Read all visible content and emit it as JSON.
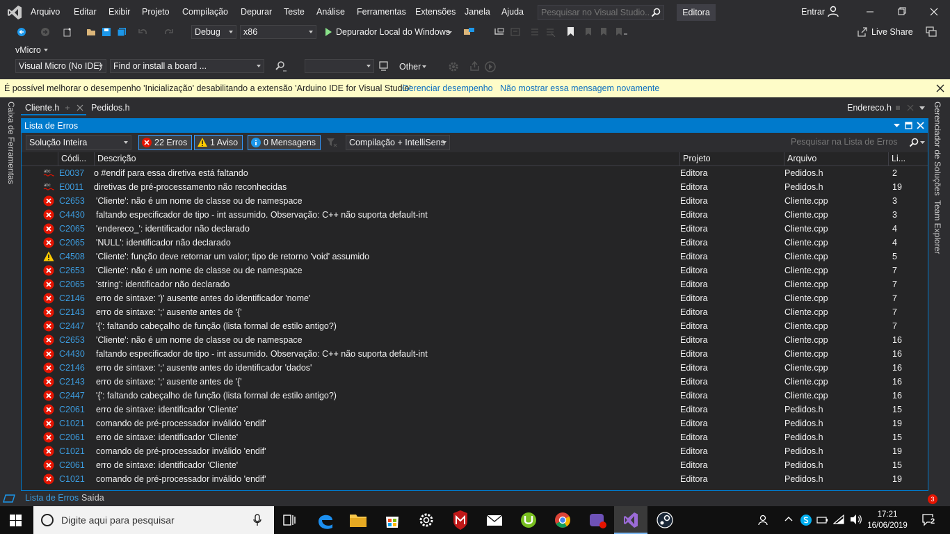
{
  "menu": {
    "items": [
      "Arquivo",
      "Editar",
      "Exibir",
      "Projeto",
      "Compilação",
      "Depurar",
      "Teste",
      "Análise",
      "Ferramentas",
      "Extensões",
      "Janela",
      "Ajuda"
    ],
    "search_placeholder": "Pesquisar no Visual Studio...",
    "solution_name": "Editora",
    "signin": "Entrar"
  },
  "toolbar": {
    "config": "Debug",
    "platform": "x86",
    "debugger": "Depurador Local do Windows",
    "live_share": "Live Share"
  },
  "vmicro": {
    "label": "vMicro",
    "board_combo": "Visual Micro (No IDE)",
    "find_board": "Find or install a board ...",
    "port_combo": "",
    "other": "Other"
  },
  "infobar": {
    "message": "É possível melhorar o desempenho 'Inicialização' desabilitando a extensão 'Arduino IDE for Visual Studio'.",
    "link1": "Gerenciar desempenho",
    "link2": "Não mostrar essa mensagem novamente"
  },
  "side": {
    "left": "Caixa de Ferramentas",
    "right1": "Gerenciador de Soluções",
    "right2": "Team Explorer"
  },
  "tabs": {
    "doc1": "Cliente.h",
    "doc2": "Pedidos.h",
    "doc3": "Endereco.h"
  },
  "errlist": {
    "title": "Lista de Erros",
    "scope": "Solução Inteira",
    "errors_btn": "22 Erros",
    "warnings_btn": "1 Aviso",
    "messages_btn": "0 Mensagens",
    "build_filter": "Compilação + IntelliSens",
    "search_placeholder": "Pesquisar na Lista de Erros",
    "columns": {
      "code": "Códi...",
      "desc": "Descrição",
      "project": "Projeto",
      "file": "Arquivo",
      "line": "Li..."
    },
    "rows": [
      {
        "sev": "intellisense",
        "code": "E0037",
        "desc": "o #endif para essa diretiva está faltando",
        "project": "Editora",
        "file": "Pedidos.h",
        "line": "2"
      },
      {
        "sev": "intellisense",
        "code": "E0011",
        "desc": "diretivas de pré-processamento não reconhecidas",
        "project": "Editora",
        "file": "Pedidos.h",
        "line": "19"
      },
      {
        "sev": "error",
        "code": "C2653",
        "desc": "'Cliente': não é um nome de classe ou de namespace",
        "project": "Editora",
        "file": "Cliente.cpp",
        "line": "3"
      },
      {
        "sev": "error",
        "code": "C4430",
        "desc": "faltando especificador de tipo - int assumido. Observação: C++ não suporta default-int",
        "project": "Editora",
        "file": "Cliente.cpp",
        "line": "3"
      },
      {
        "sev": "error",
        "code": "C2065",
        "desc": "'endereco_': identificador não declarado",
        "project": "Editora",
        "file": "Cliente.cpp",
        "line": "4"
      },
      {
        "sev": "error",
        "code": "C2065",
        "desc": "'NULL': identificador não declarado",
        "project": "Editora",
        "file": "Cliente.cpp",
        "line": "4"
      },
      {
        "sev": "warning",
        "code": "C4508",
        "desc": "'Cliente': função deve retornar um valor; tipo de retorno 'void' assumido",
        "project": "Editora",
        "file": "Cliente.cpp",
        "line": "5"
      },
      {
        "sev": "error",
        "code": "C2653",
        "desc": "'Cliente': não é um nome de classe ou de namespace",
        "project": "Editora",
        "file": "Cliente.cpp",
        "line": "7"
      },
      {
        "sev": "error",
        "code": "C2065",
        "desc": "'string': identificador não declarado",
        "project": "Editora",
        "file": "Cliente.cpp",
        "line": "7"
      },
      {
        "sev": "error",
        "code": "C2146",
        "desc": "erro de sintaxe: ')' ausente antes do identificador 'nome'",
        "project": "Editora",
        "file": "Cliente.cpp",
        "line": "7"
      },
      {
        "sev": "error",
        "code": "C2143",
        "desc": "erro de sintaxe: ';' ausente antes de '{'",
        "project": "Editora",
        "file": "Cliente.cpp",
        "line": "7"
      },
      {
        "sev": "error",
        "code": "C2447",
        "desc": "'{': faltando cabeçalho de função (lista formal de estilo antigo?)",
        "project": "Editora",
        "file": "Cliente.cpp",
        "line": "7"
      },
      {
        "sev": "error",
        "code": "C2653",
        "desc": "'Cliente': não é um nome de classe ou de namespace",
        "project": "Editora",
        "file": "Cliente.cpp",
        "line": "16"
      },
      {
        "sev": "error",
        "code": "C4430",
        "desc": "faltando especificador de tipo - int assumido. Observação: C++ não suporta default-int",
        "project": "Editora",
        "file": "Cliente.cpp",
        "line": "16"
      },
      {
        "sev": "error",
        "code": "C2146",
        "desc": "erro de sintaxe: ';' ausente antes do identificador 'dados'",
        "project": "Editora",
        "file": "Cliente.cpp",
        "line": "16"
      },
      {
        "sev": "error",
        "code": "C2143",
        "desc": "erro de sintaxe: ';' ausente antes de '{'",
        "project": "Editora",
        "file": "Cliente.cpp",
        "line": "16"
      },
      {
        "sev": "error",
        "code": "C2447",
        "desc": "'{': faltando cabeçalho de função (lista formal de estilo antigo?)",
        "project": "Editora",
        "file": "Cliente.cpp",
        "line": "16"
      },
      {
        "sev": "error",
        "code": "C2061",
        "desc": "erro de sintaxe: identificador 'Cliente'",
        "project": "Editora",
        "file": "Pedidos.h",
        "line": "15"
      },
      {
        "sev": "error",
        "code": "C1021",
        "desc": "comando de pré-processador inválido 'endif'",
        "project": "Editora",
        "file": "Pedidos.h",
        "line": "19"
      },
      {
        "sev": "error",
        "code": "C2061",
        "desc": "erro de sintaxe: identificador 'Cliente'",
        "project": "Editora",
        "file": "Pedidos.h",
        "line": "15"
      },
      {
        "sev": "error",
        "code": "C1021",
        "desc": "comando de pré-processador inválido 'endif'",
        "project": "Editora",
        "file": "Pedidos.h",
        "line": "19"
      },
      {
        "sev": "error",
        "code": "C2061",
        "desc": "erro de sintaxe: identificador 'Cliente'",
        "project": "Editora",
        "file": "Pedidos.h",
        "line": "15"
      },
      {
        "sev": "error",
        "code": "C1021",
        "desc": "comando de pré-processador inválido 'endif'",
        "project": "Editora",
        "file": "Pedidos.h",
        "line": "19"
      }
    ]
  },
  "bottom_tabs": {
    "tab1": "Lista de Erros",
    "tab2": "Saída",
    "notif_count": "3"
  },
  "taskbar": {
    "search_placeholder": "Digite aqui para pesquisar",
    "time": "17:21",
    "date": "16/06/2019",
    "notif_count": "2"
  },
  "colors": {
    "accent": "#007acc",
    "error": "#e51400",
    "warning": "#ffcc00",
    "link": "#3c9cdf"
  }
}
